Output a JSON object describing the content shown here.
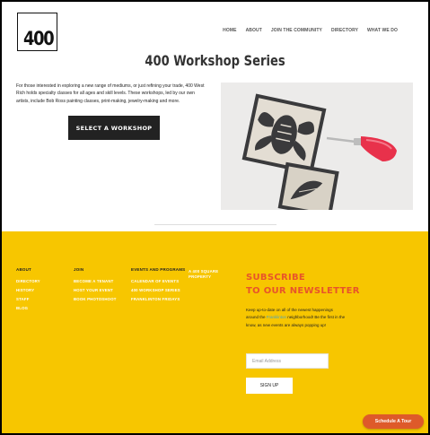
{
  "header": {
    "logo_text": "400",
    "nav": [
      {
        "label": "HOME"
      },
      {
        "label": "ABOUT"
      },
      {
        "label": "JOIN THE COMMUNITY"
      },
      {
        "label": "DIRECTORY"
      },
      {
        "label": "WHAT WE DO"
      }
    ]
  },
  "main": {
    "title": "400 Workshop Series",
    "intro": "For those interested in exploring a new range of mediums, or just refining your trade, 400 West Rich holds specialty classes for all ages and skill levels. These workshops, led by our own artists, include Bob Ross painting classes, print-making, jewelry-making and more.",
    "cta_label": "SELECT A WORKSHOP",
    "image_icon": "linocut-print-photo"
  },
  "footer": {
    "columns": [
      {
        "heading": "ABOUT",
        "links": [
          "DIRECTORY",
          "HISTORY",
          "STAFF",
          "BLOG"
        ]
      },
      {
        "heading": "JOIN",
        "links": [
          "BECOME A TENANT",
          "HOST YOUR EVENT",
          "BOOK PHOTOSHOOT"
        ]
      },
      {
        "heading": "EVENTS AND PROGRAMS",
        "links": [
          "CALENDAR OF EVENTS",
          "400 WORKSHOP SERIES",
          "FRANKLINTON FRIDAYS"
        ]
      },
      {
        "heading": "",
        "links": [
          "A 400 SQUARE",
          "PROPERTY"
        ]
      }
    ],
    "newsletter": {
      "title_line1": "SUBSCRIBE",
      "title_line2": "TO OUR NEWSLETTER",
      "text_before": "Keep up-to-date on all of the newest happenings around the ",
      "text_link": "Franklinton",
      "text_after": " neighborhood! Be the first in the know, as new events are always popping up!",
      "email_placeholder": "Email Address",
      "signup_label": "SIGN UP"
    },
    "tour_button": "Schedule A Tour"
  },
  "colors": {
    "footer_bg": "#f7c600",
    "accent": "#e8542a",
    "tour_button": "#de5a2a",
    "link": "#4aa3c2"
  }
}
